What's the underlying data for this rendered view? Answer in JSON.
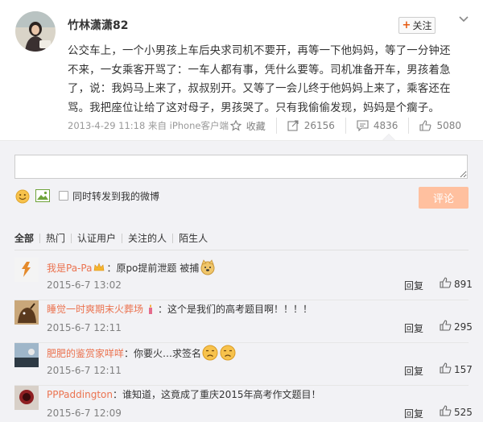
{
  "post": {
    "author": "竹林潇潇82",
    "follow_label": "关注",
    "text_lines": [
      "公交车上，一个小男孩上车后央求司机不要开，再等一下他妈妈，等了一分钟还",
      "不来，一女乘客开骂了：一车人都有事，凭什么要等。司机准备开车，男孩着急",
      "了，说：我妈马上来了，叔叔别开。又等了一会儿终于他妈妈上来了，乘客还在",
      "骂。我把座位让给了这对母子，男孩哭了。只有我偷偷发现，妈妈是个瘸子。"
    ],
    "timestamp": "2013-4-29 11:18",
    "source": "来自 iPhone客户端",
    "actions": {
      "favorite_label": "收藏",
      "forward_count": "26156",
      "comment_count": "4836",
      "like_count": "5080"
    }
  },
  "composer": {
    "placeholder": "",
    "forward_label": "同时转发到我的微博",
    "submit_label": "评论"
  },
  "filters": [
    "全部",
    "热门",
    "认证用户",
    "关注的人",
    "陌生人"
  ],
  "comments": [
    {
      "user": "我是Pa-Pa",
      "text": "：原po提前泄题 被捕",
      "time": "2015-6-7 13:02",
      "reply": "回复",
      "likes": "891"
    },
    {
      "user": "睡觉一时爽期末火葬场",
      "text": "：这个是我们的高考题目啊！！！！",
      "time": "2015-6-7 12:11",
      "reply": "回复",
      "likes": "295"
    },
    {
      "user": "肥肥的鉴赏家咩咩",
      "text": "：你要火…求签名",
      "time": "2015-6-7 12:11",
      "reply": "回复",
      "likes": "157"
    },
    {
      "user": "PPPaddington",
      "text": "：谁知道，这竟成了重庆2015年高考作文题目！",
      "time": "2015-6-7 12:09",
      "reply": "回复",
      "likes": "525"
    }
  ],
  "colors": {
    "accent": "#eb7350",
    "submit_bg": "#ffc09f",
    "comment_bg": "#f2f2f5"
  }
}
